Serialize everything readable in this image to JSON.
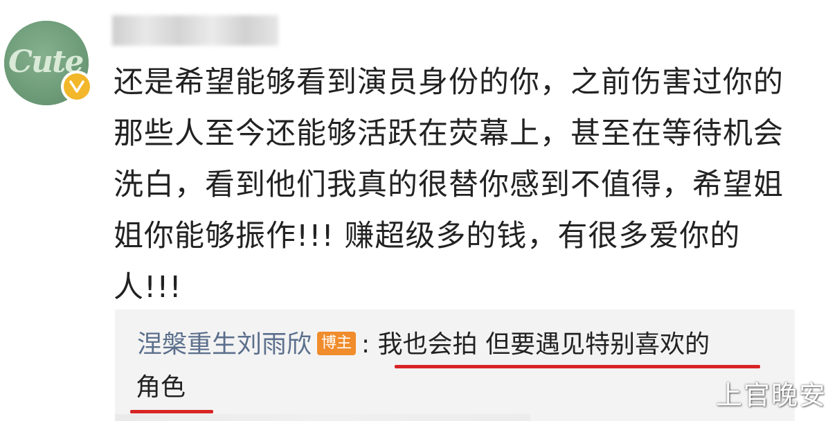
{
  "avatar": {
    "text": "Cute",
    "badge_icon": "verified-v-icon",
    "badge_color": "#f2b72a"
  },
  "comment": {
    "text": "还是希望能够看到演员身份的你，之前伤害过你的那些人至今还能够活跃在荧幕上，甚至在等待机会洗白，看到他们我真的很替你感到不值得，希望姐姐你能够振作!!! 赚超级多的钱，有很多爱你的人!!!"
  },
  "reply": {
    "author": "涅槃重生刘雨欣",
    "badge": "博主",
    "colon": ":",
    "text_line1": "我也会拍 但要遇见特别喜欢的",
    "text_line2": "角色"
  },
  "watermark": "上官晚安",
  "colors": {
    "underline": "#d82424",
    "author": "#5b6f8c",
    "badge": "#f08c2b"
  }
}
